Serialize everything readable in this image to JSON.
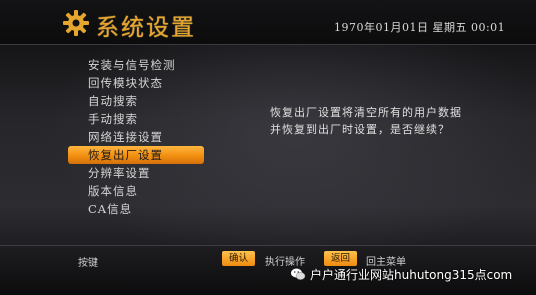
{
  "header": {
    "title": "系统设置",
    "datetime": "1970年01月01日  星期五  00:01"
  },
  "menu": {
    "items": [
      {
        "label": "安装与信号检测"
      },
      {
        "label": "回传模块状态"
      },
      {
        "label": "自动搜索"
      },
      {
        "label": "手动搜索"
      },
      {
        "label": "网络连接设置"
      },
      {
        "label": "恢复出厂设置",
        "selected": true
      },
      {
        "label": "分辨率设置"
      },
      {
        "label": "版本信息"
      },
      {
        "label": "CA信息"
      }
    ]
  },
  "message": {
    "line1": "恢复出厂设置将清空所有的用户数据",
    "line2": "并恢复到出厂时设置，是否继续？"
  },
  "footer": {
    "hint_label": "按键",
    "confirm_key": "确认",
    "confirm_desc": "执行操作",
    "back_key": "返回",
    "back_desc": "回主菜单"
  },
  "watermark": {
    "text": "户户通行业网站huhutong315点com"
  },
  "colors": {
    "accent": "#f29a1c",
    "title": "#e6a52c"
  },
  "icons": [
    "gear-icon",
    "wechat-logo-icon"
  ]
}
